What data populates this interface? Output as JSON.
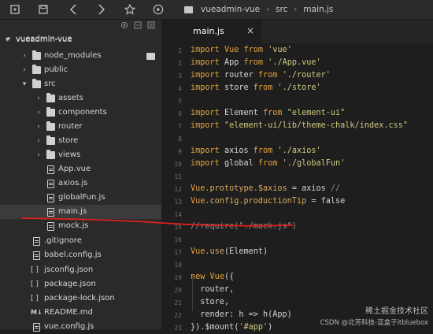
{
  "toolbar": {
    "icons": [
      "file-icon",
      "save-icon",
      "back-icon",
      "forward-icon",
      "star-icon",
      "play-icon"
    ],
    "breadcrumb": [
      "vueadmin-vue",
      "src",
      "main.js"
    ]
  },
  "sidebar": {
    "root": "vueadmin-vue",
    "items": [
      {
        "label": "node_modules",
        "type": "folder"
      },
      {
        "label": "public",
        "type": "folder"
      },
      {
        "label": "src",
        "type": "folder-open"
      },
      {
        "label": "assets",
        "type": "folder"
      },
      {
        "label": "components",
        "type": "folder"
      },
      {
        "label": "router",
        "type": "folder"
      },
      {
        "label": "store",
        "type": "folder"
      },
      {
        "label": "views",
        "type": "folder"
      },
      {
        "label": "App.vue",
        "type": "file"
      },
      {
        "label": "axios.js",
        "type": "file"
      },
      {
        "label": "globalFun.js",
        "type": "file"
      },
      {
        "label": "main.js",
        "type": "file"
      },
      {
        "label": "mock.js",
        "type": "file"
      },
      {
        "label": ".gitignore",
        "type": "file"
      },
      {
        "label": "babel.config.js",
        "type": "file"
      },
      {
        "label": "jsconfig.json",
        "type": "json"
      },
      {
        "label": "package.json",
        "type": "json"
      },
      {
        "label": "package-lock.json",
        "type": "json"
      },
      {
        "label": "README.md",
        "type": "md"
      },
      {
        "label": "vue.config.js",
        "type": "file"
      }
    ]
  },
  "editor": {
    "tab_label": "main.js",
    "tab_close": "×",
    "line_numbers": [
      "1",
      "2",
      "3",
      "4",
      "5",
      "6",
      "7",
      "8",
      "9",
      "10",
      "11",
      "12",
      "13",
      "14",
      "15",
      "16",
      "17",
      "18",
      "19",
      "20",
      "21",
      "22",
      "23"
    ],
    "lines": [
      "import Vue from 'vue'",
      "import App from './App.vue'",
      "import router from './router'",
      "import store from './store'",
      "",
      "import Element from \"element-ui\"",
      "import \"element-ui/lib/theme-chalk/index.css\"",
      "",
      "import axios from './axios'",
      "import global from './globalFun'",
      "",
      "Vue.prototype.$axios = axios //",
      "Vue.config.productionTip = false",
      "",
      "//require(\"./mock.js\")",
      "",
      "Vue.use(Element)",
      "",
      "new Vue({",
      "  router,",
      "  store,",
      "  render: h => h(App)",
      "}).$mount('#app')"
    ]
  },
  "watermark": {
    "line1": "稀土掘金技术社区",
    "line2": "CSDN @北芳科技-蓝盒子itbluebox"
  },
  "colors": {
    "keyword": "#e5a33a",
    "string": "#cfc97f",
    "comment": "#8d8d8d",
    "annotation": "#e02020"
  }
}
